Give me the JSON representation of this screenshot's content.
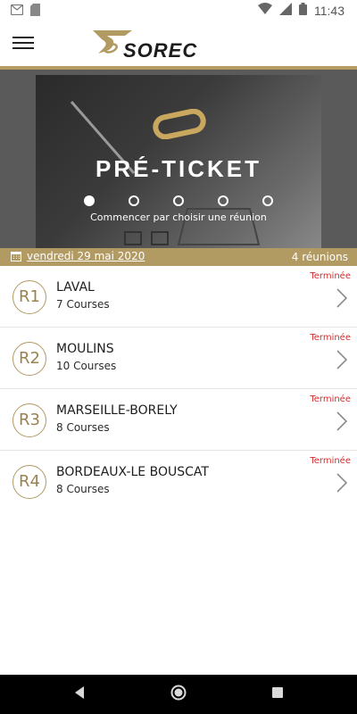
{
  "status_bar": {
    "time": "11:43",
    "icons": [
      "gmail-icon",
      "sd-card-icon",
      "wifi-icon",
      "signal-icon",
      "battery-icon"
    ]
  },
  "header": {
    "logo_text": "SOREC",
    "menu_icon": "hamburger-menu-icon"
  },
  "banner": {
    "title": "PRÉ-TICKET",
    "subtitle": "Commencer par choisir une réunion",
    "pages": 5,
    "active_page": 1
  },
  "date_bar": {
    "date": "vendredi 29 mai 2020",
    "count": "4 réunions",
    "icon": "calendar-icon"
  },
  "meetings": [
    {
      "code": "R1",
      "name": "LAVAL",
      "courses": "7 Courses",
      "status": "Terminée"
    },
    {
      "code": "R2",
      "name": "MOULINS",
      "courses": "10 Courses",
      "status": "Terminée"
    },
    {
      "code": "R3",
      "name": "MARSEILLE-BORELY",
      "courses": "8 Courses",
      "status": "Terminée"
    },
    {
      "code": "R4",
      "name": "BORDEAUX-LE BOUSCAT",
      "courses": "8 Courses",
      "status": "Terminée"
    }
  ],
  "colors": {
    "gold": "#b29a63",
    "status_red": "#d62b2b"
  }
}
